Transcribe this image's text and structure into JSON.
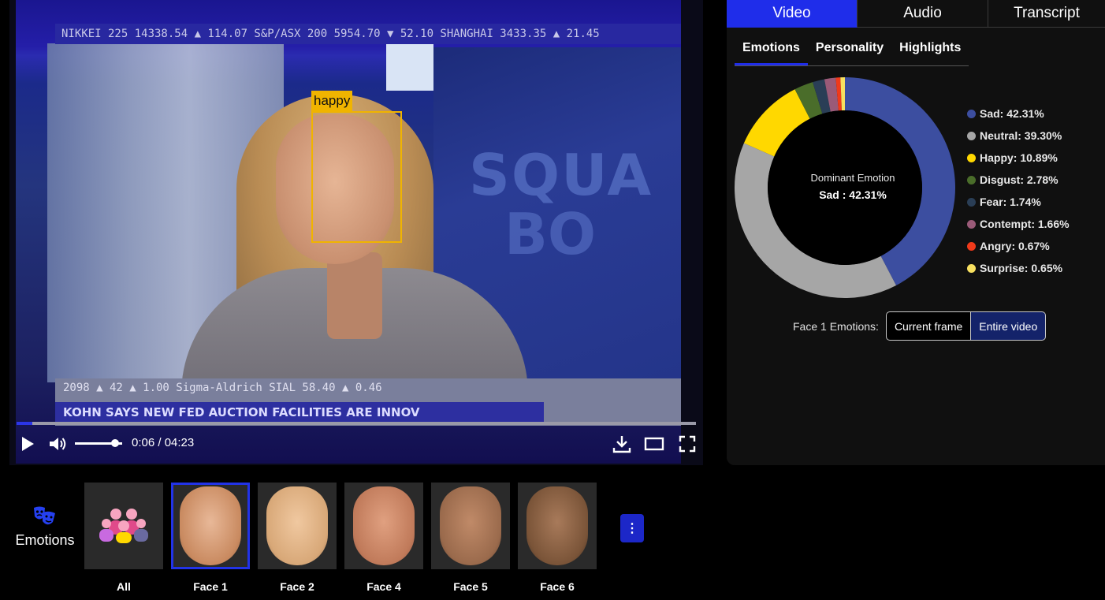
{
  "video": {
    "face_label": "happy",
    "time_display": "0:06 / 04:23",
    "progress_fraction": 0.023,
    "volume_fraction": 0.85,
    "ticker_top": "NIKKEI 225 14338.54 ▲ 114.07   S&P/ASX 200 5954.70 ▼ 52.10   SHANGHAI 3433.35 ▲ 21.45",
    "ticker_bottom_1": "2098 ▲ 42 ▲ 1.00   Sigma-Aldrich SIAL 58.40 ▲ 0.46",
    "ticker_bottom_2": "KOHN SAYS NEW FED AUCTION FACILITIES ARE INNOV",
    "studio_text_1": "SQUA",
    "studio_text_2": "BO"
  },
  "tabs": {
    "main": [
      "Video",
      "Audio",
      "Transcript"
    ],
    "sub": [
      "Emotions",
      "Personality",
      "Highlights"
    ]
  },
  "chart_data": {
    "type": "pie",
    "center_title": "Dominant Emotion",
    "center_value": "Sad : 42.31%",
    "slices": [
      {
        "label": "Sad",
        "value": 42.31,
        "color": "#3c4ea0",
        "text": "Sad: 42.31%"
      },
      {
        "label": "Neutral",
        "value": 39.3,
        "color": "#a6a6a6",
        "text": "Neutral: 39.30%"
      },
      {
        "label": "Happy",
        "value": 10.89,
        "color": "#ffd800",
        "text": "Happy: 10.89%"
      },
      {
        "label": "Disgust",
        "value": 2.78,
        "color": "#4a6d2a",
        "text": "Disgust: 2.78%"
      },
      {
        "label": "Fear",
        "value": 1.74,
        "color": "#2a3e56",
        "text": "Fear: 1.74%"
      },
      {
        "label": "Contempt",
        "value": 1.66,
        "color": "#9a5a78",
        "text": "Contempt: 1.66%"
      },
      {
        "label": "Angry",
        "value": 0.67,
        "color": "#f03a1a",
        "text": "Angry: 0.67%"
      },
      {
        "label": "Surprise",
        "value": 0.65,
        "color": "#f7e060",
        "text": "Surprise: 0.65%"
      }
    ]
  },
  "scope": {
    "label": "Face 1 Emotions:",
    "current_frame": "Current frame",
    "entire_video": "Entire video"
  },
  "faces": {
    "section_label": "Emotions",
    "items": [
      {
        "label": "All",
        "tone": "#2b2b2b"
      },
      {
        "label": "Face 1",
        "tone": "#d8a07a"
      },
      {
        "label": "Face 2",
        "tone": "#d9b08a"
      },
      {
        "label": "Face 4",
        "tone": "#c8886a"
      },
      {
        "label": "Face 5",
        "tone": "#a87a5c"
      },
      {
        "label": "Face 6",
        "tone": "#8a6650"
      }
    ],
    "more": "⋮"
  }
}
